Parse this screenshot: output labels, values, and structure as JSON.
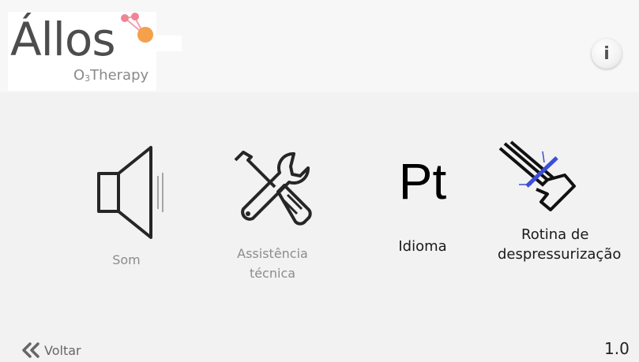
{
  "header": {
    "logo_word": "Állos",
    "logo_sub_prefix": "O",
    "logo_sub_index": "3",
    "logo_sub_suffix": "Therapy",
    "info_label": "i"
  },
  "menu": {
    "sound": {
      "label": "Som",
      "icon": "speaker-icon"
    },
    "tech_support": {
      "label_line1": "Assistência",
      "label_line2": "técnica",
      "icon": "wrench-screwdriver-icon"
    },
    "language": {
      "icon_text": "Pt",
      "label": "Idioma"
    },
    "depressurization": {
      "label_line1": "Rotina de",
      "label_line2": "despressurização",
      "icon": "depressurization-valve-icon"
    }
  },
  "footer": {
    "back_label": "Voltar",
    "version": "1.0"
  },
  "colors": {
    "logo_orange": "#f5a04a",
    "logo_pink": "#ee7a8a",
    "valve_blue": "#3b4fd6",
    "text_gray": "#8c8c8c"
  }
}
